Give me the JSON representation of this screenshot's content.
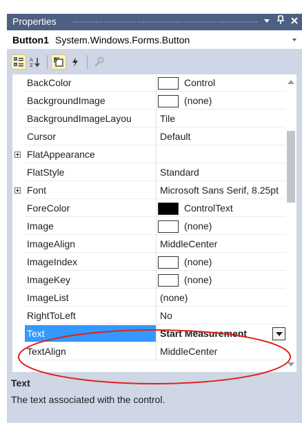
{
  "window": {
    "title": "Properties",
    "dropdown_glyph": "▼",
    "pin_glyph": "ᵩ",
    "close_glyph": "✕"
  },
  "object_selector": {
    "name": "Button1",
    "type": "System.Windows.Forms.Button"
  },
  "toolbar": {
    "buttons": [
      {
        "name": "categorized-icon",
        "active": true
      },
      {
        "name": "alphabetical-icon",
        "active": false
      },
      {
        "name": "properties-icon",
        "active": true
      },
      {
        "name": "events-icon",
        "active": false
      },
      {
        "name": "property-pages-icon",
        "active": false
      }
    ]
  },
  "properties": [
    {
      "name": "BackColor",
      "value": "Control",
      "swatch": "#ffffff"
    },
    {
      "name": "BackgroundImage",
      "value": "(none)",
      "swatch": "#ffffff"
    },
    {
      "name": "BackgroundImageLayou",
      "value": "Tile"
    },
    {
      "name": "Cursor",
      "value": "Default"
    },
    {
      "name": "FlatAppearance",
      "value": "",
      "expandable": true
    },
    {
      "name": "FlatStyle",
      "value": "Standard"
    },
    {
      "name": "Font",
      "value": "Microsoft Sans Serif, 8.25pt",
      "expandable": true
    },
    {
      "name": "ForeColor",
      "value": "ControlText",
      "swatch": "#000000"
    },
    {
      "name": "Image",
      "value": "(none)",
      "swatch": "#ffffff"
    },
    {
      "name": "ImageAlign",
      "value": "MiddleCenter"
    },
    {
      "name": "ImageIndex",
      "value": "(none)",
      "swatch": "#ffffff"
    },
    {
      "name": "ImageKey",
      "value": "(none)",
      "swatch": "#ffffff"
    },
    {
      "name": "ImageList",
      "value": "(none)"
    },
    {
      "name": "RightToLeft",
      "value": "No"
    },
    {
      "name": "Text",
      "value": "Start Measurement",
      "selected": true
    },
    {
      "name": "TextAlign",
      "value": "MiddleCenter"
    }
  ],
  "description": {
    "title": "Text",
    "text": "The text associated with the control."
  },
  "colors": {
    "panel_background": "#cfd6e5",
    "title_bar": "#4d6082",
    "selection": "#3399ff",
    "annotation_ellipse": "#e0201b"
  }
}
